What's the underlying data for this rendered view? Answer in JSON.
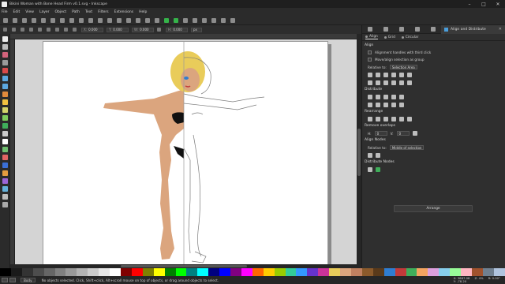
{
  "window": {
    "title": "Bikini Woman with Bone Head Firm v0.1.svg - Inkscape",
    "controls": [
      "–",
      "□",
      "✕"
    ]
  },
  "menu": [
    "File",
    "Edit",
    "View",
    "Layer",
    "Object",
    "Path",
    "Text",
    "Filters",
    "Extensions",
    "Help"
  ],
  "controls_bar": {
    "x_label": "X:",
    "x_value": "0.000",
    "y_label": "Y:",
    "y_value": "0.000",
    "w_label": "W:",
    "w_value": "0.000",
    "h_label": "H:",
    "h_value": "0.000",
    "units": "px"
  },
  "panel": {
    "tab_title": "Align and Distribute",
    "close": "✕",
    "subtabs": [
      "Align",
      "Grid",
      "Circular"
    ],
    "align": {
      "heading": "Align",
      "opt_handles": "Alignment handles with third click",
      "opt_group": "Move/align selection as group",
      "relative_label": "Relative to:",
      "relative_value": "Selection Area"
    },
    "distribute_heading": "Distribute",
    "rearrange_heading": "Rearrange",
    "remove_overlap": {
      "heading": "Remove overlaps",
      "h_label": "H:",
      "h_value": "0",
      "v_label": "V:",
      "v_value": "0"
    },
    "align_nodes": {
      "heading": "Align Nodes",
      "relative_label": "Relative to:",
      "relative_value": "Middle of selection"
    },
    "distribute_nodes_heading": "Distribute Nodes",
    "arrange_button": "Arrange"
  },
  "status": {
    "layer": "Body",
    "message": "No objects selected. Click, Shift+click, Alt+scroll mouse on top of objects, or drag around objects to select.",
    "x_label": "X:",
    "x_value": "3887.08",
    "y_label": "Y:",
    "y_value": "-78.20",
    "zoom_label": "Z:",
    "zoom_value": "4%",
    "rotation_label": "R:",
    "rotation_value": "0.00°"
  },
  "colors": {
    "skin": "#dba57e",
    "hair": "#e9cc5a",
    "accent": "#3fae5a"
  }
}
